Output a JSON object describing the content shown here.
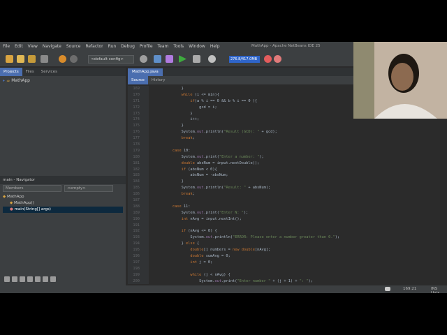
{
  "window": {
    "title": "MathApp - Apache NetBeans IDE 25"
  },
  "menu": [
    "File",
    "Edit",
    "View",
    "Navigate",
    "Source",
    "Refactor",
    "Run",
    "Debug",
    "Profile",
    "Team",
    "Tools",
    "Window",
    "Help"
  ],
  "toolbar": {
    "config": "<default config>",
    "memory": "276.8/417.0MB"
  },
  "projects_panel": {
    "tabs": [
      "Projects",
      "Files",
      "Services"
    ],
    "tree": [
      "MathApp"
    ]
  },
  "navigator": {
    "title": "main - Navigator",
    "members_label": "Members",
    "filter_value": "<empty>",
    "tree": {
      "root": "MathApp",
      "items": [
        "MathApp()",
        "main(String[] args)"
      ]
    }
  },
  "editor": {
    "file_tab": "MathApp.java",
    "subtabs": [
      "Source",
      "History"
    ],
    "lines": [
      {
        "n": "169",
        "t": "              }"
      },
      {
        "n": "170",
        "t": "              while (i <= min){"
      },
      {
        "n": "171",
        "t": "                  if(a % i == 0 && b % i == 0 ){"
      },
      {
        "n": "172",
        "t": "                      gcd = i;"
      },
      {
        "n": "173",
        "t": "                  }"
      },
      {
        "n": "174",
        "t": "                  i++;"
      },
      {
        "n": "175",
        "t": "              }"
      },
      {
        "n": "176",
        "t": "              System.out.println(\"Result (GCD): \" + gcd);"
      },
      {
        "n": "177",
        "t": "              break;"
      },
      {
        "n": "178",
        "t": ""
      },
      {
        "n": "179",
        "t": "          case 10:"
      },
      {
        "n": "180",
        "t": "              System.out.print(\"Enter a number: \");"
      },
      {
        "n": "181",
        "t": "              double absNum = input.nextDouble();"
      },
      {
        "n": "182",
        "t": "              if (absNum < 0){"
      },
      {
        "n": "183",
        "t": "                  absNum = -absNum;"
      },
      {
        "n": "184",
        "t": "              }"
      },
      {
        "n": "185",
        "t": "              System.out.println(\"Result: \" + absNum);"
      },
      {
        "n": "186",
        "t": "              break;"
      },
      {
        "n": "187",
        "t": ""
      },
      {
        "n": "188",
        "t": "          case 11:"
      },
      {
        "n": "189",
        "t": "              System.out.print(\"Enter N: \");"
      },
      {
        "n": "190",
        "t": "              int nAvg = input.nextInt();"
      },
      {
        "n": "191",
        "t": ""
      },
      {
        "n": "192",
        "t": "              if (nAvg <= 0) {"
      },
      {
        "n": "193",
        "t": "                  System.out.println(\"ERROR: Please enter a number greater than 0.\");"
      },
      {
        "n": "194",
        "t": "              } else {"
      },
      {
        "n": "195",
        "t": "                  double[] numbers = new double[nAvg];"
      },
      {
        "n": "196",
        "t": "                  double sumAvg = 0;"
      },
      {
        "n": "197",
        "t": "                  int j = 0;"
      },
      {
        "n": "198",
        "t": ""
      },
      {
        "n": "199",
        "t": "                  while (j < nAvg) {"
      },
      {
        "n": "200",
        "t": "                      System.out.print(\"Enter number \" + (j + 1) + \": \");"
      }
    ]
  },
  "status": {
    "position": "169:21",
    "mode": "INS Unix"
  },
  "colors": {
    "accent": "#4b6eaf",
    "editor_bg": "#2b2b2b",
    "panel_bg": "#3c3f41"
  }
}
